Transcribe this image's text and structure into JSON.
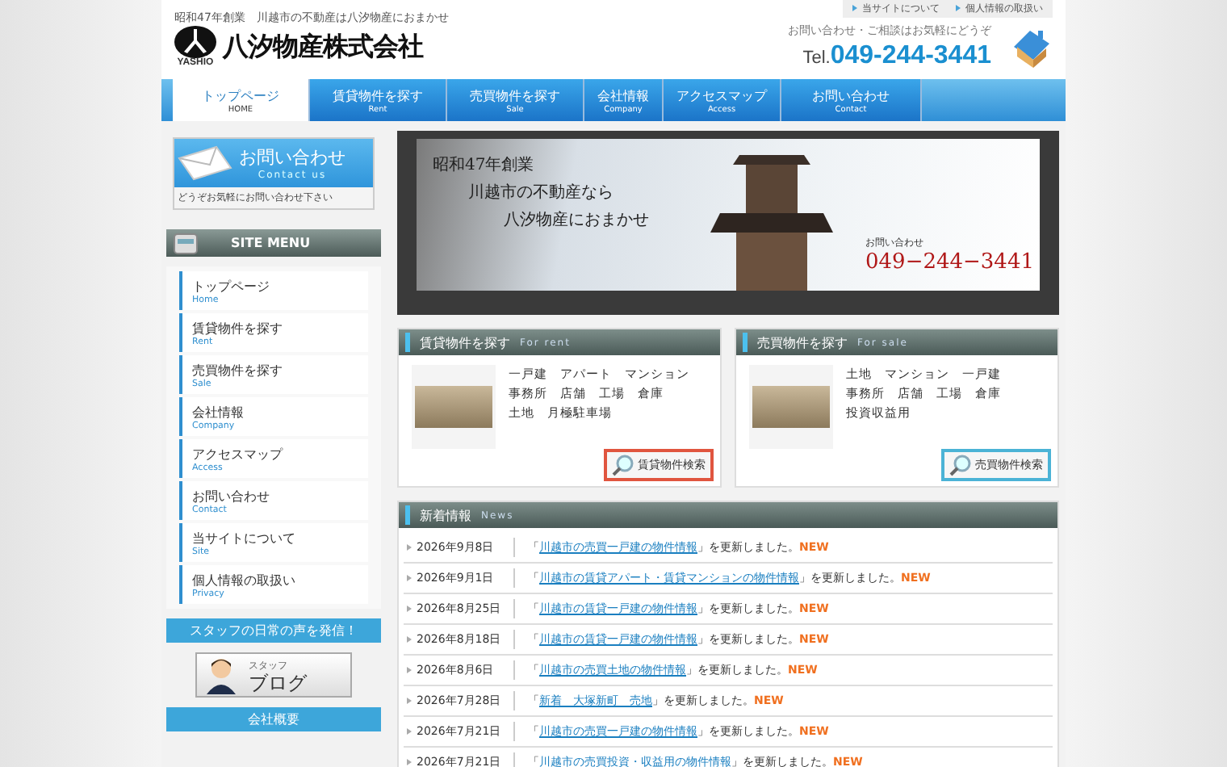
{
  "header": {
    "tagline": "昭和47年創業　川越市の不動産は八汐物産におまかせ",
    "logo_mark": "YASHIO",
    "company": "八汐物産株式会社",
    "utility_links": [
      "当サイトについて",
      "個人情報の取扱い"
    ],
    "contact_note": "お問い合わせ・ご相談はお気軽にどうぞ",
    "tel_prefix": "Tel.",
    "tel": "049-244-3441"
  },
  "nav": [
    {
      "label": "トップページ",
      "sub": "HOME",
      "selected": true
    },
    {
      "label": "賃貸物件を探す",
      "sub": "Rent",
      "selected": false
    },
    {
      "label": "売買物件を探す",
      "sub": "Sale",
      "selected": false
    },
    {
      "label": "会社情報",
      "sub": "Company",
      "selected": false
    },
    {
      "label": "アクセスマップ",
      "sub": "Access",
      "selected": false
    },
    {
      "label": "お問い合わせ",
      "sub": "Contact",
      "selected": false
    }
  ],
  "sidebar": {
    "contact_banner": {
      "title": "お問い合わせ",
      "sub": "Contact us",
      "note": "どうぞお気軽にお問い合わせ下さい"
    },
    "menu_title": "SITE MENU",
    "menu": [
      {
        "label": "トップページ",
        "sub": "Home"
      },
      {
        "label": "賃貸物件を探す",
        "sub": "Rent"
      },
      {
        "label": "売買物件を探す",
        "sub": "Sale"
      },
      {
        "label": "会社情報",
        "sub": "Company"
      },
      {
        "label": "アクセスマップ",
        "sub": "Access"
      },
      {
        "label": "お問い合わせ",
        "sub": "Contact"
      },
      {
        "label": "当サイトについて",
        "sub": "Site"
      },
      {
        "label": "個人情報の取扱い",
        "sub": "Privacy"
      }
    ],
    "staff_heading": "スタッフの日常の声を発信！",
    "blog_small": "スタッフ",
    "blog_big": "ブログ",
    "company_heading": "会社概要"
  },
  "hero": {
    "lines": [
      "昭和47年創業",
      "川越市の不動産なら",
      "八汐物産におまかせ"
    ],
    "contact_label": "お問い合わせ",
    "tel": "049−244−3441"
  },
  "cards": [
    {
      "title": "賃貸物件を探す",
      "sub": "For rent",
      "lines": [
        "一戸建　アパート　マンション",
        "事務所　店舗　工場　倉庫",
        "土地　月極駐車場"
      ],
      "button": "賃貸物件検索",
      "color": "#e0553f"
    },
    {
      "title": "売買物件を探す",
      "sub": "For sale",
      "lines": [
        "土地　マンション　一戸建",
        "事務所　店舗　工場　倉庫",
        "投資収益用"
      ],
      "button": "売買物件検索",
      "color": "#4bb3d6"
    }
  ],
  "news": {
    "title": "新着情報",
    "sub": "News",
    "items": [
      {
        "date": "2026年9月8日",
        "open": "「",
        "link": "川越市の売買一戸建の物件情報",
        "after": "」を更新しました。",
        "badge": "NEW"
      },
      {
        "date": "2026年9月1日",
        "open": "「",
        "link": "川越市の賃貸アパート・賃貸マンションの物件情報",
        "after": "」を更新しました。",
        "badge": "NEW"
      },
      {
        "date": "2026年8月25日",
        "open": "「",
        "link": "川越市の賃貸一戸建の物件情報",
        "after": "」を更新しました。",
        "badge": "NEW"
      },
      {
        "date": "2026年8月18日",
        "open": "「",
        "link": "川越市の賃貸一戸建の物件情報",
        "after": "」を更新しました。",
        "badge": "NEW"
      },
      {
        "date": "2026年8月6日",
        "open": "「",
        "link": "川越市の売買土地の物件情報",
        "after": "」を更新しました。",
        "badge": "NEW"
      },
      {
        "date": "2026年7月28日",
        "open": "「",
        "link": "新着　大塚新町　売地",
        "after": "」を更新しました。",
        "badge": "NEW"
      },
      {
        "date": "2026年7月21日",
        "open": "「",
        "link": "川越市の売買一戸建の物件情報",
        "after": "」を更新しました。",
        "badge": "NEW"
      },
      {
        "date": "2026年7月21日",
        "open": "「",
        "link": "川越市の売買投資・収益用の物件情報",
        "after": "」を更新しました。",
        "badge": "NEW"
      }
    ]
  }
}
